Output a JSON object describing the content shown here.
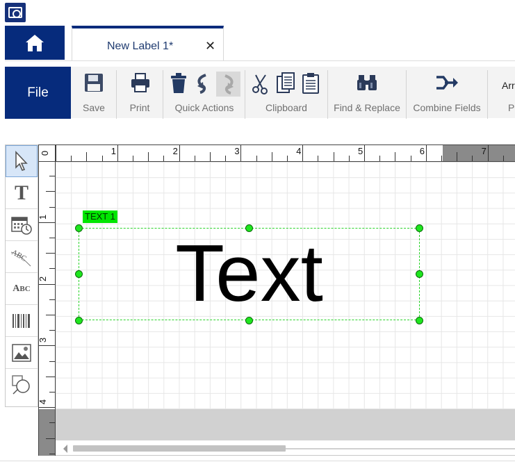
{
  "tabs": {
    "active_label": "New Label 1*",
    "close_glyph": "✕"
  },
  "ribbon": {
    "file_label": "File",
    "groups": {
      "save": "Save",
      "print": "Print",
      "quick_actions": "Quick Actions",
      "clipboard": "Clipboard",
      "find_replace": "Find & Replace",
      "combine_fields": "Combine Fields",
      "arrange_partial": "Arr",
      "partial_group": "Po"
    }
  },
  "tools": [
    "select-tool",
    "text-tool",
    "date-time-tool",
    "curved-text-tool",
    "small-caps-text-tool",
    "barcode-tool",
    "image-tool",
    "shape-tool"
  ],
  "rulers": {
    "top_numbers": [
      "0",
      "1",
      "2",
      "3",
      "4",
      "5",
      "6",
      "7"
    ],
    "left_numbers": [
      "1",
      "2",
      "3",
      "4"
    ]
  },
  "canvas_object": {
    "tag_label": "TEXT 1",
    "content": "Text"
  },
  "colors": {
    "brand": "#062b7c",
    "selection": "#1ee61e",
    "tag": "#00e600"
  }
}
